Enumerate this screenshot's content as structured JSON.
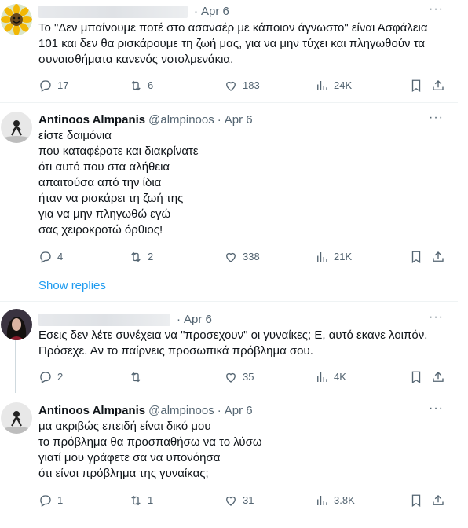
{
  "tweets": [
    {
      "name": "",
      "handle": "",
      "date": "Apr 6",
      "text": "Το \"Δεν μπαίνουμε ποτέ στο ασανσέρ με κάποιον άγνωστο\" είναι Ασφάλεια 101 και δεν θα ρισκάρουμε τη ζωή μας, για να μην τύχει και πληγωθούν τα συναισθήματα κανενός νοτολμενάκια.",
      "replies": "17",
      "retweets": "6",
      "likes": "183",
      "views": "24K",
      "avatar_icon": "sunflower-icon"
    },
    {
      "name": "Antinoos Almpanis",
      "handle": "@almpinoos",
      "date": "Apr 6",
      "text": "είστε δαιμόνια\nπου καταφέρατε και διακρίνατε\nότι αυτό που στα αλήθεια\nαπαιτούσα από την ίδια\nήταν να ρισκάρει τη ζωή της\nγια να μην πληγωθώ εγώ\nσας χειροκροτώ όρθιος!",
      "replies": "4",
      "retweets": "2",
      "likes": "338",
      "views": "21K",
      "avatar_icon": "silhouette-avatar-icon"
    },
    {
      "name": "",
      "handle": "",
      "date": "Apr 6",
      "text": "Εσεις δεν λέτε συνέχεια να \"προσεχουν\" οι γυναίκες; Ε, αυτό εκανε λοιπόν. Πρόσεχε. Αν το παίρνεις προσωπικά πρόβλημα σου.",
      "replies": "2",
      "retweets": "",
      "likes": "35",
      "views": "4K",
      "avatar_icon": "woman-avatar-icon"
    },
    {
      "name": "Antinoos Almpanis",
      "handle": "@almpinoos",
      "date": "Apr 6",
      "text": "μα ακριβώς επειδή είναι δικό μου\nτο πρόβλημα θα προσπαθήσω να το λύσω\nγιατί μου γράφετε σα να υπονόησα\nότι είναι πρόβλημα της γυναίκας;",
      "replies": "1",
      "retweets": "1",
      "likes": "31",
      "views": "3.8K",
      "avatar_icon": "silhouette-avatar-icon"
    }
  ],
  "show_replies_label": "Show replies",
  "more_label": "···",
  "colors": {
    "accent": "#1d9bf0",
    "muted": "#536471",
    "text": "#0f1419",
    "divider": "#eff3f4"
  }
}
